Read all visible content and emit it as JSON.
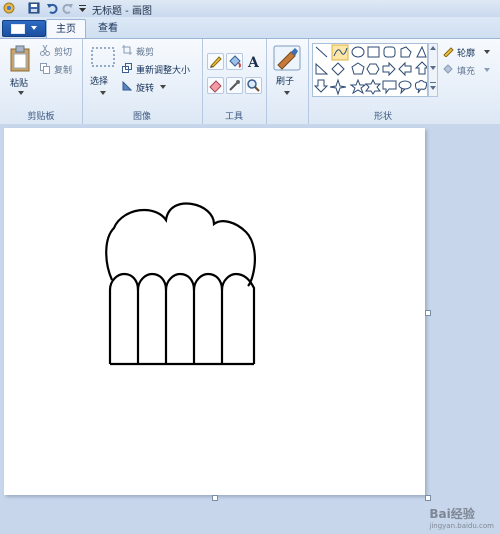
{
  "window": {
    "title": "无标题 - 画图"
  },
  "tabs": [
    {
      "label": "主页",
      "active": true
    },
    {
      "label": "查看",
      "active": false
    }
  ],
  "clipboard": {
    "paste": "粘贴",
    "cut": "剪切",
    "copy": "复制",
    "group": "剪贴板"
  },
  "image": {
    "select": "选择",
    "crop": "裁剪",
    "resize": "重新调整大小",
    "rotate": "旋转",
    "group": "图像"
  },
  "tools": {
    "group": "工具"
  },
  "brushes": {
    "label": "刷子"
  },
  "shapes": {
    "outline": "轮廓",
    "fill": "填充",
    "group": "形状"
  },
  "watermark": {
    "brand": "Bai经验",
    "url": "jingyan.baidu.com"
  },
  "colors": {
    "accent": "#1b4f9e",
    "ribbon_bg": "#eaf1fa",
    "work_bg": "#c7d6ea"
  }
}
